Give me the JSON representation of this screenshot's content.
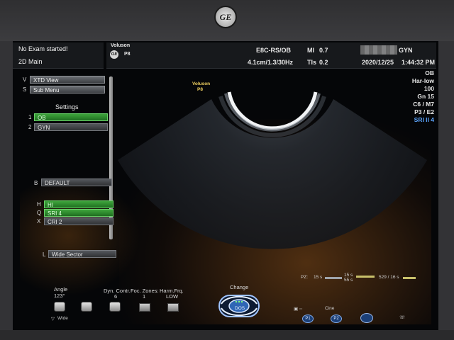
{
  "device": {
    "brand_logo": "GE"
  },
  "header": {
    "exam_status": "No Exam started!",
    "mode": "2D Main",
    "system_name": "Voluson",
    "probe_code": "P8",
    "probe_name": "E8C-RS/OB",
    "mi_label": "MI",
    "mi_value": "0.7",
    "patient_app": "GYN",
    "depth_freq": "4.1cm/1.3/30Hz",
    "tis_label": "TIs",
    "tis_value": "0.2",
    "date": "2020/12/25",
    "time": "1:44:32 PM"
  },
  "left_menu": {
    "xtd_view": {
      "key": "V",
      "label": "XTD View"
    },
    "sub_menu": {
      "key": "S",
      "label": "Sub Menu"
    },
    "settings_title": "Settings",
    "settings_items": [
      {
        "key": "1",
        "label": "OB",
        "state": "active"
      },
      {
        "key": "2",
        "label": "GYN",
        "state": "normal"
      }
    ],
    "default_item": {
      "key": "B",
      "label": "DEFAULT"
    },
    "toggles": [
      {
        "key": "H",
        "label": "HI",
        "state": "on"
      },
      {
        "key": "Q",
        "label": "SRI 4",
        "state": "on"
      },
      {
        "key": "X",
        "label": "CRI 2",
        "state": "off"
      }
    ],
    "wide_sector": {
      "key": "L",
      "label": "Wide Sector"
    }
  },
  "image_overlay": {
    "system_name": "Voluson",
    "probe_code": "P8"
  },
  "right_params": [
    "OB",
    "Har-low",
    "100",
    "Gn 15",
    "C6 / M7",
    "P3 / E2",
    "SRI II 4"
  ],
  "bottom_controls": {
    "angle": {
      "label": "Angle",
      "value": "123°"
    },
    "dyn_contr": {
      "label": "Dyn. Contr.",
      "value": "6"
    },
    "foc_zones": {
      "label": "Foc. Zones:",
      "value": "1"
    },
    "harm_frq": {
      "label": "Harm.Frq.",
      "value": "LOW"
    },
    "wide_toggle": "Wide",
    "change_label": "Change",
    "center_button": "DOS",
    "cine_label": "Cine",
    "p1": "P1",
    "p2": "P2",
    "timeline": {
      "label": "PZ:",
      "t1": "15 s",
      "t2": "15 s",
      "t3": "55 s",
      "counter": "529 / 16 s"
    }
  },
  "colors": {
    "menu_green": "#2f8f2e",
    "accent_blue": "#3b6fb8",
    "param_blue": "#5da6ff"
  }
}
